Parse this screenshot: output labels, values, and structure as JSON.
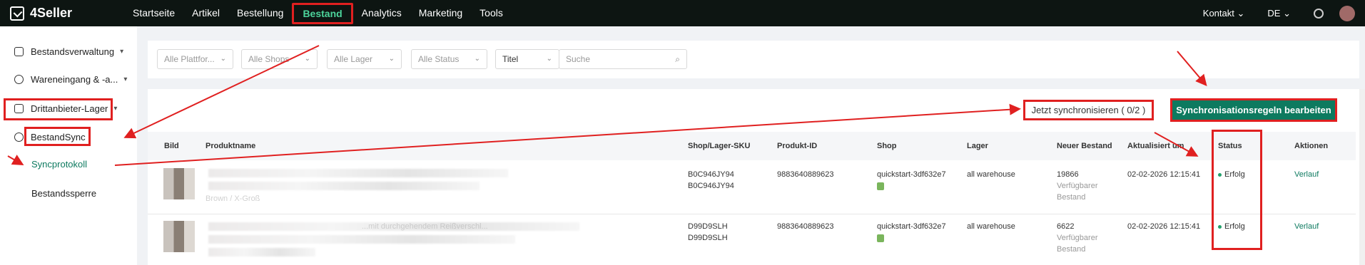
{
  "app": {
    "logo": "4Seller"
  },
  "nav": {
    "items": [
      "Startseite",
      "Artikel",
      "Bestellung",
      "Bestand",
      "Analytics",
      "Marketing",
      "Tools"
    ],
    "active": "Bestand",
    "contact": "Kontakt",
    "language": "DE"
  },
  "sidebar": {
    "items": [
      {
        "label": "Bestandsverwaltung"
      },
      {
        "label": "Wareneingang & -a..."
      },
      {
        "label": "Drittanbieter-Lager"
      },
      {
        "label": "BestandSync"
      },
      {
        "label": "Syncprotokoll"
      },
      {
        "label": "Bestandssperre"
      }
    ]
  },
  "filters": {
    "platform": "Alle Plattfor...",
    "shops": "Alle Shops",
    "warehouse": "Alle Lager",
    "status": "Alle Status",
    "field": "Titel",
    "search_placeholder": "Suche"
  },
  "actions": {
    "sync_now": "Jetzt synchronisieren ( 0/2 )",
    "edit_rules": "Synchronisationsregeln bearbeiten"
  },
  "table": {
    "headers": [
      "Bild",
      "Produktname",
      "Shop/Lager-SKU",
      "Produkt-ID",
      "Shop",
      "Lager",
      "Neuer Bestand",
      "Aktualisiert um",
      "Status",
      "Aktionen"
    ],
    "rows": [
      {
        "name_sub": "Brown / X-Groß",
        "sku1": "B0C946JY94",
        "sku2": "B0C946JY94",
        "product_id": "9883640889623",
        "shop": "quickstart-3df632e7",
        "warehouse": "all warehouse",
        "stock": "19866",
        "stock_note1": "Verfügbarer",
        "stock_note2": "Bestand",
        "updated": "02-02-2026 12:15:41",
        "status": "Erfolg",
        "action": "Verlauf"
      },
      {
        "name_sub": "...mit durchgehendem Reißverschl...",
        "sku1": "D99D9SLH",
        "sku2": "D99D9SLH",
        "product_id": "9883640889623",
        "shop": "quickstart-3df632e7",
        "warehouse": "all warehouse",
        "stock": "6622",
        "stock_note1": "Verfügbarer",
        "stock_note2": "Bestand",
        "updated": "02-02-2026 12:15:41",
        "status": "Erfolg",
        "action": "Verlauf"
      }
    ]
  },
  "colors": {
    "accent": "#0d7a5f",
    "annotation": "#e02020",
    "nav_bg": "#0d1512"
  }
}
